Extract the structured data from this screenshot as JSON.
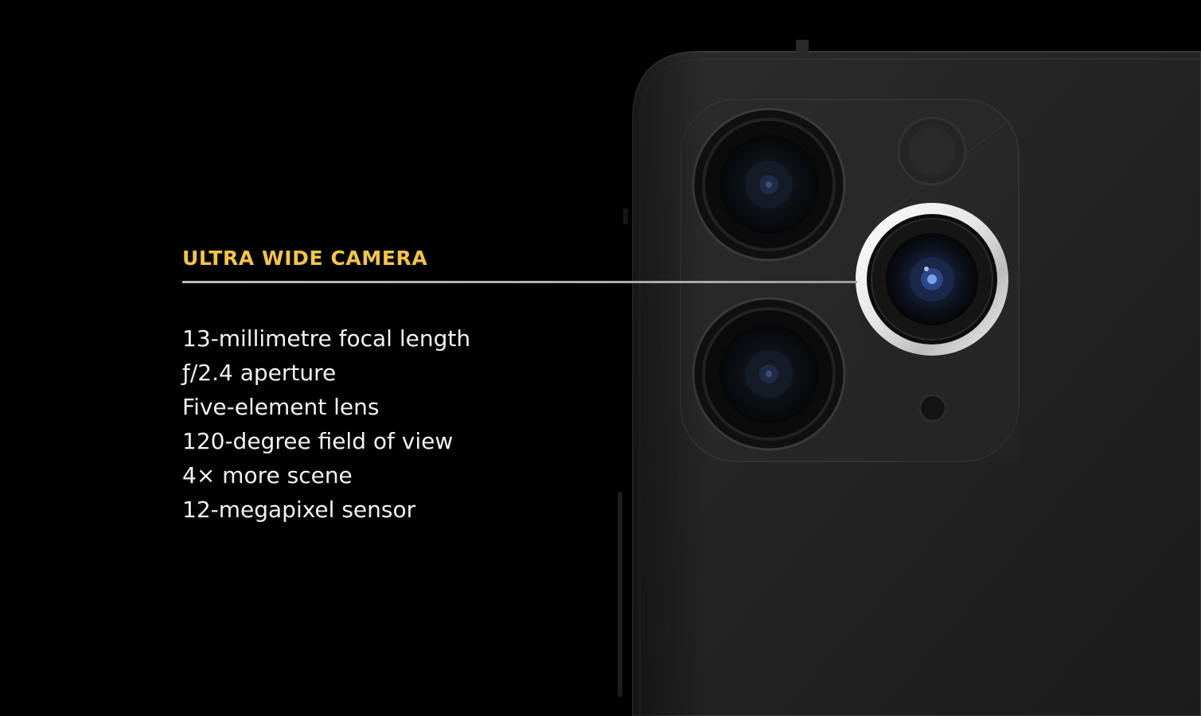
{
  "feature": {
    "title": "ULTRA WIDE CAMERA",
    "accent_color": "#f5c542",
    "specs": [
      "13-millimetre focal length",
      "ƒ/2.4 aperture",
      "Five-element lens",
      "120-degree field of view",
      "4× more scene",
      "12-megapixel sensor"
    ]
  },
  "illustration": {
    "subject": "phone-rear-triple-camera",
    "highlighted_lens": "ultra-wide-lens"
  }
}
